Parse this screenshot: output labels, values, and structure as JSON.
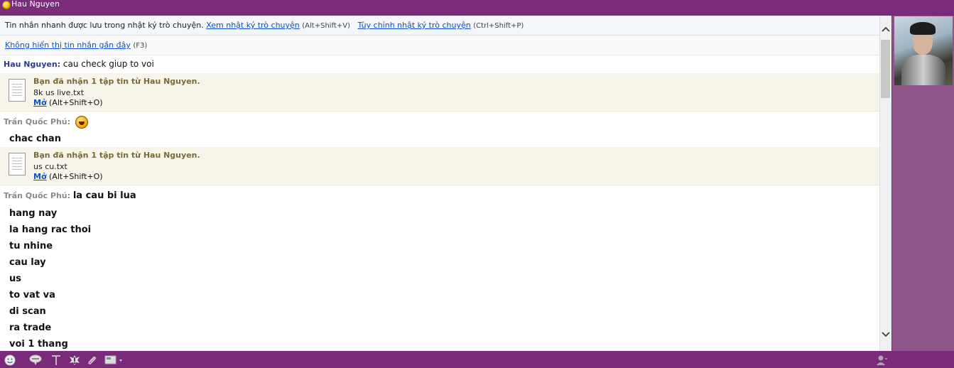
{
  "window": {
    "title": "Hau Nguyen"
  },
  "notice": {
    "text": "Tin nhắn nhanh được lưu trong nhật ký trò chuyện.",
    "view_log_link": "Xem nhật ký trò chuyện",
    "view_log_shortcut": "(Alt+Shift+V)",
    "customize_log_link": "Tùy chỉnh nhật ký trò chuyện",
    "customize_log_shortcut": "(Ctrl+Shift+P)"
  },
  "recent": {
    "hide_link": "Không hiển thị tin nhắn gần đây",
    "shortcut": "(F3)"
  },
  "messages": [
    {
      "sender": "Hau Nguyen:",
      "text": "cau check giup to voi"
    },
    {
      "sender": "Trần Quốc Phú:",
      "text": "",
      "emoticon": "laughing-emoticon"
    },
    {
      "text": "chac chan"
    },
    {
      "sender": "Trần Quốc Phú:",
      "text": "la cau bi lua"
    }
  ],
  "files": [
    {
      "title": "Bạn đã nhận 1 tập tin từ Hau Nguyen.",
      "name": "8k us live.txt",
      "open_label": "Mở",
      "open_shortcut": "(Alt+Shift+O)"
    },
    {
      "title": "Bạn đã nhận 1 tập tin từ Hau Nguyen.",
      "name": "us cu.txt",
      "open_label": "Mở",
      "open_shortcut": "(Alt+Shift+O)"
    }
  ],
  "continuation_lines": [
    "hang nay",
    "la hang rac thoi",
    "tu nhine",
    "cau lay",
    "us",
    "to vat va",
    "di scan",
    "ra trade",
    "voi 1 thang"
  ],
  "toolbar_icons": [
    "emoticon-icon",
    "audible-icon",
    "text-format-icon",
    "buzz-icon",
    "attach-file-icon",
    "share-screen-icon",
    "contact-icon"
  ],
  "colors": {
    "frame": "#7a2a7a",
    "sidebar": "#8e5589",
    "link": "#0b4fcf",
    "file_bg": "#f7f5ea"
  }
}
